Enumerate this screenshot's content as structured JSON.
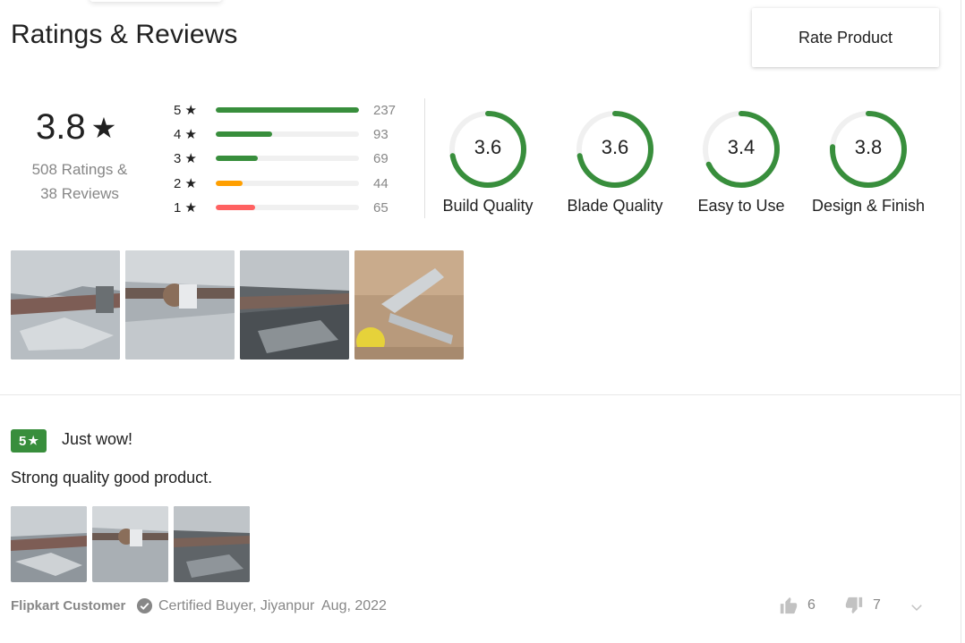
{
  "header": {
    "title": "Ratings & Reviews",
    "rate_button": "Rate Product"
  },
  "summary": {
    "average": "3.8",
    "star_glyph": "★",
    "ratings_line": "508 Ratings &",
    "reviews_line": "38 Reviews"
  },
  "histogram": [
    {
      "label": "5 ★",
      "count": "237",
      "value": 237,
      "color": "#388e3c"
    },
    {
      "label": "4 ★",
      "count": "93",
      "value": 93,
      "color": "#388e3c"
    },
    {
      "label": "3 ★",
      "count": "69",
      "value": 69,
      "color": "#388e3c"
    },
    {
      "label": "2 ★",
      "count": "44",
      "value": 44,
      "color": "#ff9f00"
    },
    {
      "label": "1 ★",
      "count": "65",
      "value": 65,
      "color": "#ff6161"
    }
  ],
  "histogram_max": 237,
  "features": [
    {
      "name": "Build Quality",
      "score": "3.6",
      "value": 3.6
    },
    {
      "name": "Blade Quality",
      "score": "3.6",
      "value": 3.6
    },
    {
      "name": "Easy to Use",
      "score": "3.4",
      "value": 3.4
    },
    {
      "name": "Design & Finish",
      "score": "3.8",
      "value": 3.8
    }
  ],
  "feature_max": 5,
  "colors": {
    "accent_green": "#388e3c",
    "track_gray": "#f0f0f0",
    "muted_text": "#878787"
  },
  "review": {
    "rating": "5",
    "star_glyph": "★",
    "title": "Just wow!",
    "text": "Strong quality good product.",
    "author": "Flipkart Customer",
    "certified": "Certified Buyer, Jiyanpur",
    "date": "Aug, 2022",
    "likes": "6",
    "dislikes": "7"
  },
  "icons": {
    "certified": "check-circle-icon",
    "like": "thumbs-up-icon",
    "dislike": "thumbs-down-icon",
    "expand": "chevron-down-icon"
  }
}
